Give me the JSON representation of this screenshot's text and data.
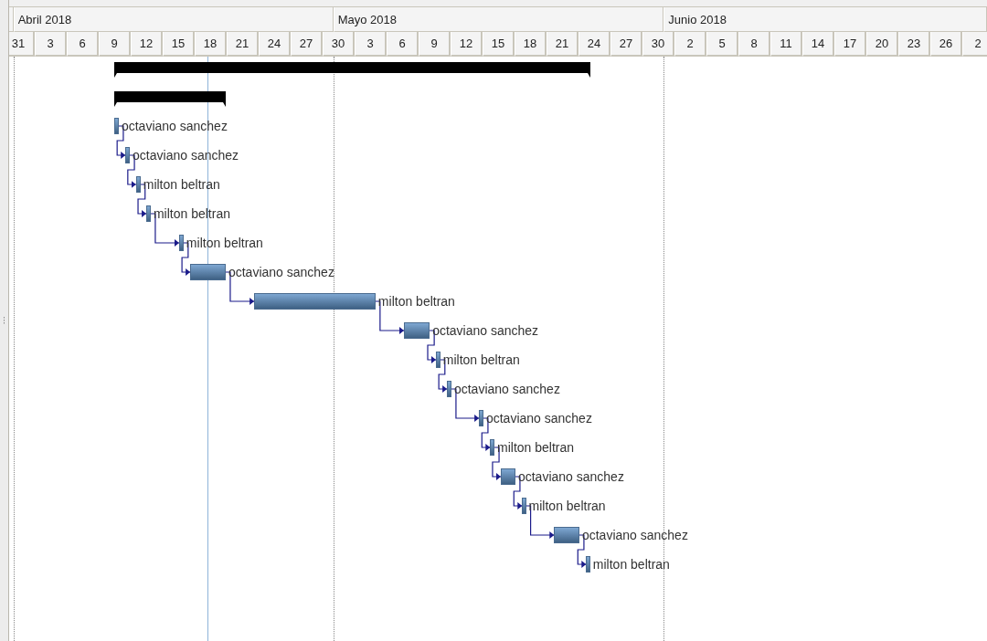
{
  "timeline": {
    "months": [
      {
        "label": "Abril 2018"
      },
      {
        "label": "Mayo 2018"
      },
      {
        "label": "Junio 2018"
      }
    ],
    "day_labels": [
      "31",
      "3",
      "6",
      "9",
      "12",
      "15",
      "18",
      "21",
      "24",
      "27",
      "30",
      "3",
      "6",
      "9",
      "12",
      "15",
      "18",
      "21",
      "24",
      "27",
      "30",
      "2",
      "5",
      "8",
      "11",
      "14",
      "17",
      "20",
      "23",
      "26",
      "2"
    ]
  },
  "tasks": [
    {
      "kind": "summary"
    },
    {
      "kind": "summary"
    },
    {
      "kind": "task",
      "resource": "octaviano sanchez"
    },
    {
      "kind": "task",
      "resource": "octaviano sanchez"
    },
    {
      "kind": "task",
      "resource": "milton beltran"
    },
    {
      "kind": "task",
      "resource": "milton beltran"
    },
    {
      "kind": "task",
      "resource": "milton beltran"
    },
    {
      "kind": "task",
      "resource": "octaviano sanchez"
    },
    {
      "kind": "task",
      "resource": "milton beltran"
    },
    {
      "kind": "task",
      "resource": "octaviano sanchez"
    },
    {
      "kind": "task",
      "resource": "milton beltran"
    },
    {
      "kind": "task",
      "resource": "octaviano sanchez"
    },
    {
      "kind": "task",
      "resource": "octaviano sanchez"
    },
    {
      "kind": "task",
      "resource": "milton beltran"
    },
    {
      "kind": "task",
      "resource": "octaviano sanchez"
    },
    {
      "kind": "task",
      "resource": "milton beltran"
    },
    {
      "kind": "task",
      "resource": "octaviano sanchez"
    },
    {
      "kind": "task",
      "resource": "milton beltran"
    }
  ]
}
